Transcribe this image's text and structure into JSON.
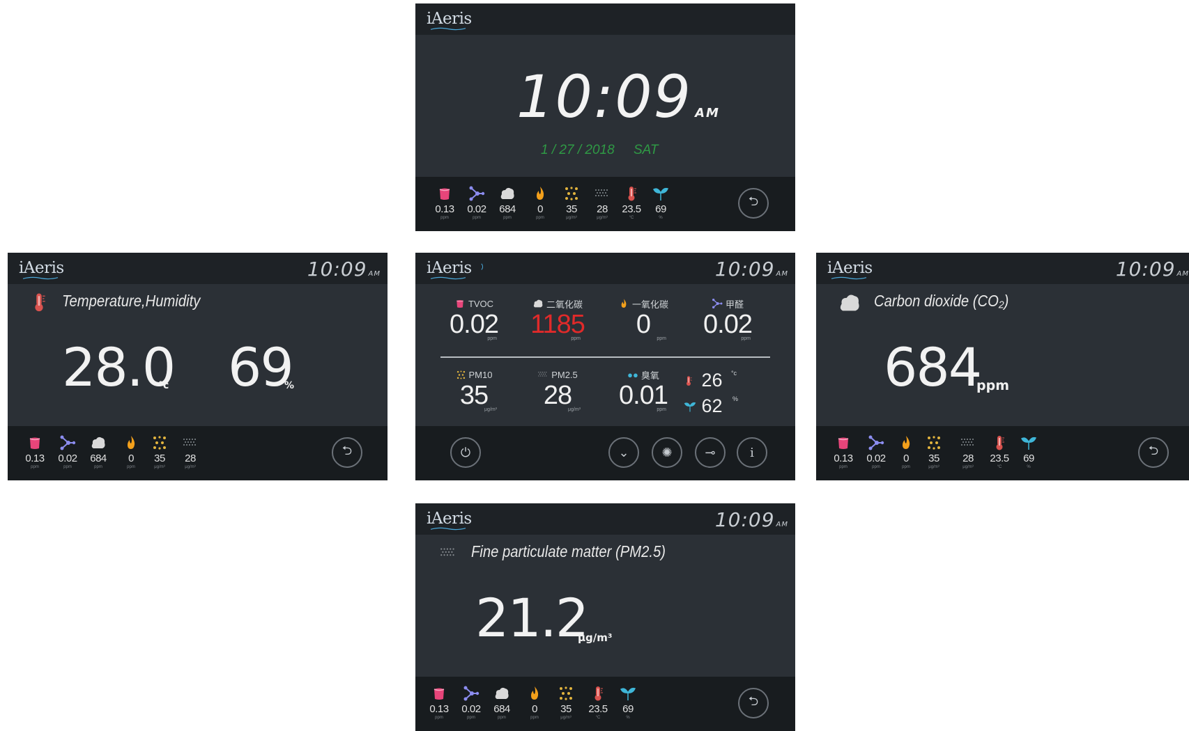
{
  "brand": "iAeris",
  "clock": {
    "time": "10:09",
    "ampm": "AM",
    "date": "1 / 27 / 2018",
    "weekday": "SAT"
  },
  "header_time": "10:09",
  "header_ampm": "AM",
  "units": {
    "ppm": "ppm",
    "ugm3": "μg/m³",
    "celsius": "°C",
    "percent": "%"
  },
  "mini": {
    "tvoc": "0.13",
    "hcho": "0.02",
    "co2": "684",
    "co": "0",
    "pm10": "35",
    "pm25": "28",
    "temp": "23.5",
    "hum": "69"
  },
  "temp_screen": {
    "title": "Temperature,Humidity",
    "temp": "28.0",
    "temp_unit": "°c",
    "hum": "69",
    "hum_unit": "%"
  },
  "dashboard": {
    "tvoc_label": "TVOC",
    "tvoc": "0.02",
    "co2_label": "二氧化碳",
    "co2": "1185",
    "co_label": "一氧化碳",
    "co": "0",
    "hcho_label": "甲醛",
    "hcho": "0.02",
    "pm10_label": "PM10",
    "pm10": "35",
    "pm25_label": "PM2.5",
    "pm25": "28",
    "o3_label": "臭氧",
    "o3": "0.01",
    "temp": "26",
    "temp_unit": "°c",
    "hum": "62",
    "hum_unit": "%"
  },
  "co2_screen": {
    "title": "Carbon dioxide (CO₂)",
    "value": "684",
    "unit": "ppm"
  },
  "pm_screen": {
    "title": "Fine particulate matter (PM2.5)",
    "value": "21.2",
    "unit": "μg/m³"
  },
  "colors": {
    "tvoc": "#e7457a",
    "hcho": "#8c8df0",
    "co": "#f3a01b",
    "pm10": "#e2b43e",
    "temp": "#d9534f",
    "hum": "#3fb6d8",
    "date": "#2f9a45",
    "co2_alert": "#e02a2a"
  },
  "icons": [
    "tvoc-icon",
    "formaldehyde-icon",
    "co2-cloud-icon",
    "co-flame-icon",
    "pm10-dots-icon",
    "pm25-dots-icon",
    "thermometer-icon",
    "humidity-leaf-icon",
    "back-icon",
    "power-icon",
    "chevron-down-icon",
    "brightness-icon",
    "key-icon",
    "info-icon",
    "wifi-icon"
  ]
}
